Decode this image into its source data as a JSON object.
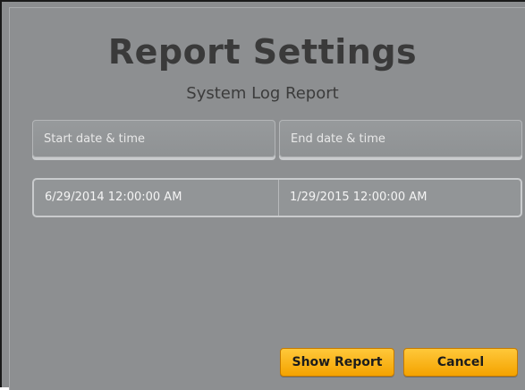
{
  "header": {
    "title": "Report Settings",
    "subtitle": "System Log Report"
  },
  "fields": {
    "start_label": "Start date & time",
    "end_label": "End date & time",
    "start_value": "6/29/2014 12:00:00 AM",
    "end_value": "1/29/2015 12:00:00 AM"
  },
  "buttons": {
    "show_report": "Show Report",
    "cancel": "Cancel"
  },
  "colors": {
    "background": "#8d8f91",
    "accent": "#f4a300"
  }
}
